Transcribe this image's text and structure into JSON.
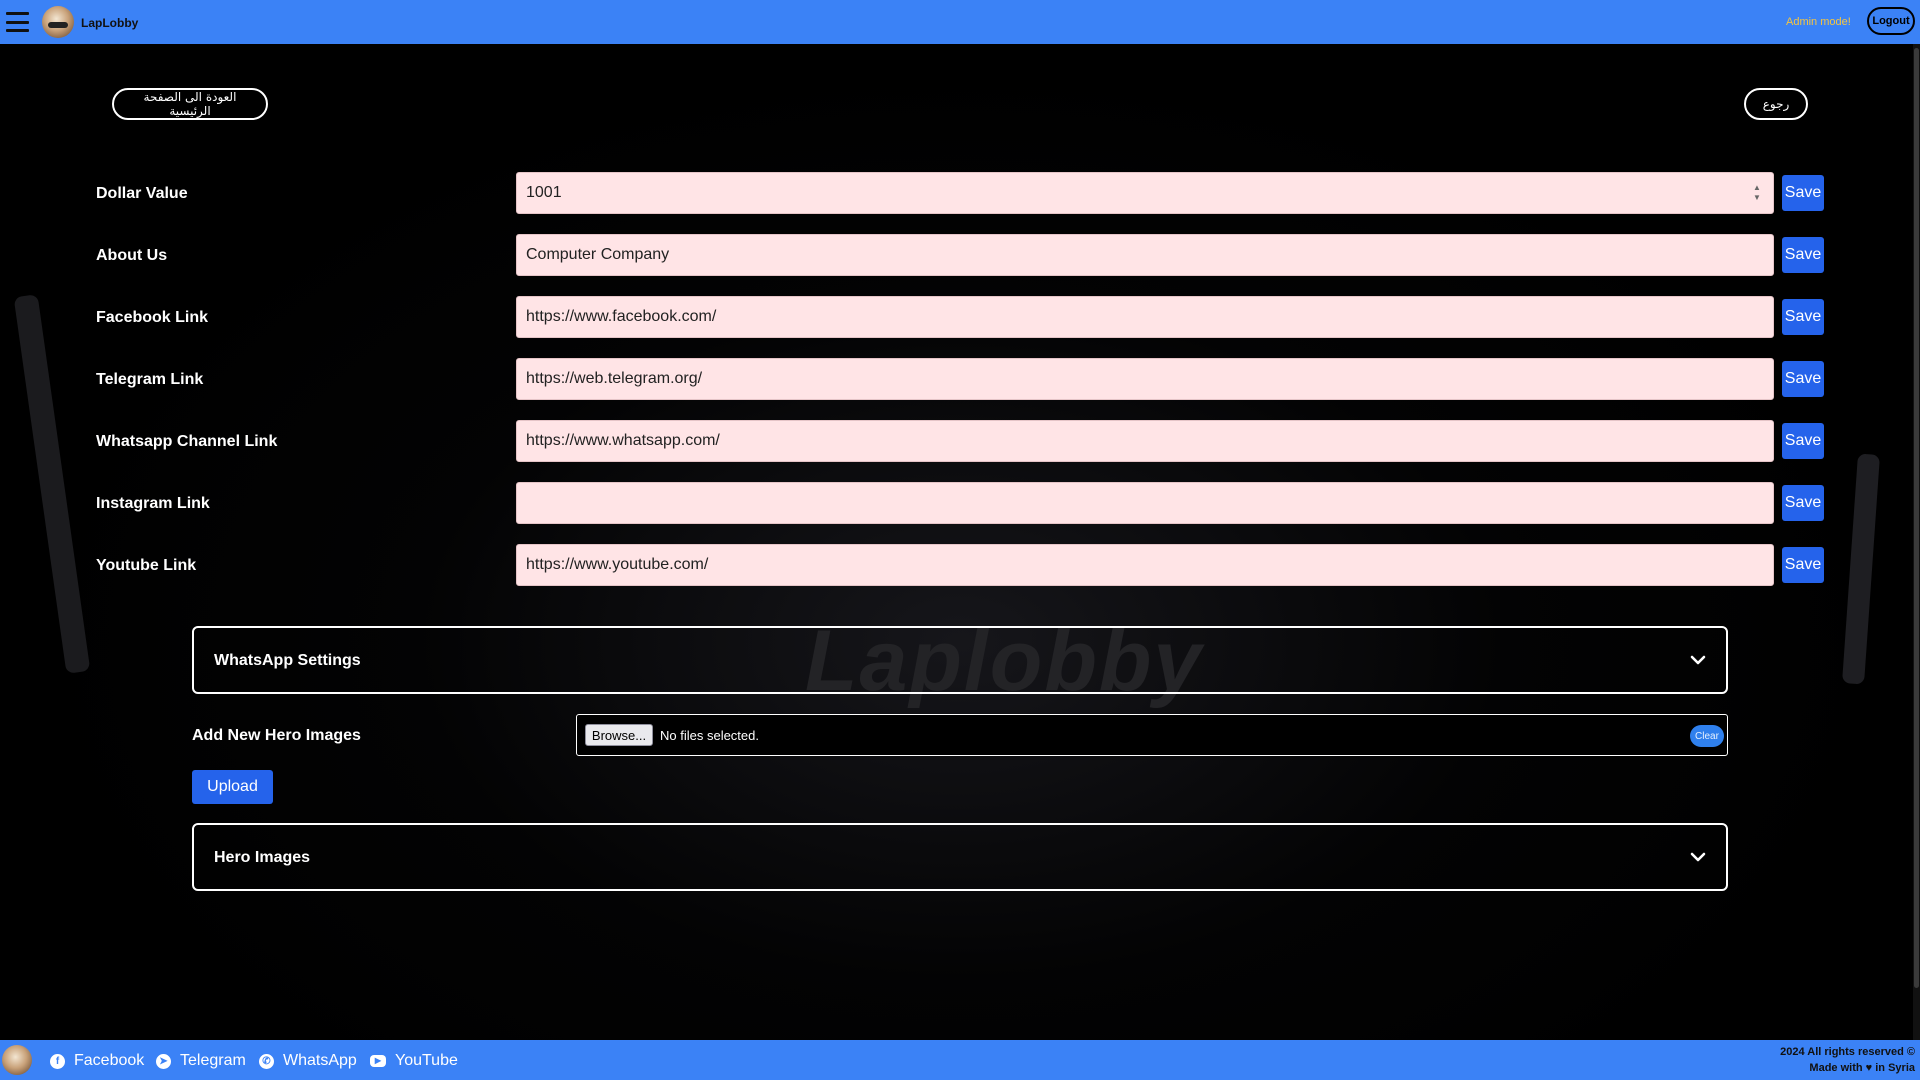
{
  "header": {
    "brand": "LapLobby",
    "admin_mode": "Admin mode!",
    "logout_label": "Logout"
  },
  "nav": {
    "home_label": "العودة الى الصفحة الرئيسية",
    "back_label": "رجوع"
  },
  "settings": [
    {
      "label": "Dollar Value",
      "value": "1001",
      "save": "Save"
    },
    {
      "label": "About Us",
      "value": "Computer Company",
      "save": "Save"
    },
    {
      "label": "Facebook Link",
      "value": "https://www.facebook.com/",
      "save": "Save"
    },
    {
      "label": "Telegram Link",
      "value": "https://web.telegram.org/",
      "save": "Save"
    },
    {
      "label": "Whatsapp Channel Link",
      "value": "https://www.whatsapp.com/",
      "save": "Save"
    },
    {
      "label": "Instagram Link",
      "value": "",
      "save": "Save"
    },
    {
      "label": "Youtube Link",
      "value": "https://www.youtube.com/",
      "save": "Save"
    }
  ],
  "whatsapp_panel": {
    "title": "WhatsApp Settings"
  },
  "hero_upload": {
    "label": "Add New Hero Images",
    "browse_label": "Browse...",
    "file_status": "No files selected.",
    "clear_label": "Clear",
    "upload_label": "Upload"
  },
  "hero_panel": {
    "title": "Hero Images"
  },
  "background": {
    "watermark": "Laplobby"
  },
  "footer": {
    "links": [
      {
        "label": "Facebook",
        "icon": "facebook-icon"
      },
      {
        "label": "Telegram",
        "icon": "telegram-icon"
      },
      {
        "label": "WhatsApp",
        "icon": "whatsapp-icon"
      },
      {
        "label": "YouTube",
        "icon": "youtube-icon"
      }
    ],
    "copyright_line1": "2024 All rights reserved ©",
    "copyright_line2_pre": "Made with",
    "copyright_line2_post": "in Syria"
  },
  "colors": {
    "accent": "#3b82f6",
    "button": "#2563eb",
    "input_bg": "#ffe4e6",
    "admin_text": "#f4c542"
  }
}
